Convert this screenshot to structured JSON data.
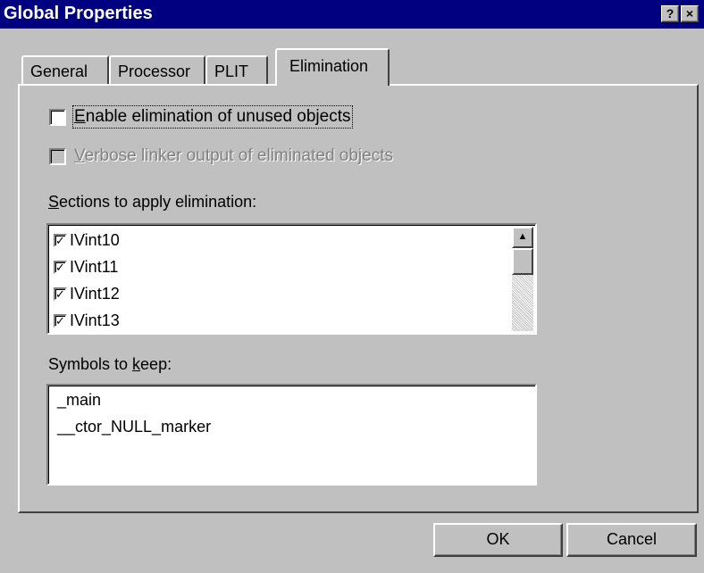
{
  "window": {
    "title": "Global Properties",
    "help_label": "?",
    "close_label": "×"
  },
  "tabs": [
    {
      "label": "General"
    },
    {
      "label": "Processor"
    },
    {
      "label": "PLIT"
    },
    {
      "label": "Elimination",
      "active": true
    }
  ],
  "options": {
    "enable_elimination": {
      "label_accel": "E",
      "label_rest": "nable elimination of unused objects",
      "checked": false
    },
    "verbose_output": {
      "label_accel": "V",
      "label_rest": "erbose linker output of eliminated objects",
      "checked": false,
      "disabled": true
    }
  },
  "sections": {
    "label_accel": "S",
    "label_rest": "ections to apply elimination:",
    "items": [
      {
        "name": "IVint10",
        "checked": true
      },
      {
        "name": "IVint11",
        "checked": true
      },
      {
        "name": "IVint12",
        "checked": true
      },
      {
        "name": "IVint13",
        "checked": true
      }
    ]
  },
  "symbols": {
    "label_pre": "Symbols to ",
    "label_accel": "k",
    "label_post": "eep:",
    "items": [
      "_main",
      "__ctor_NULL_marker"
    ]
  },
  "buttons": {
    "ok": "OK",
    "cancel": "Cancel"
  },
  "check_glyph": "✓",
  "scroll_up_glyph": "▲"
}
